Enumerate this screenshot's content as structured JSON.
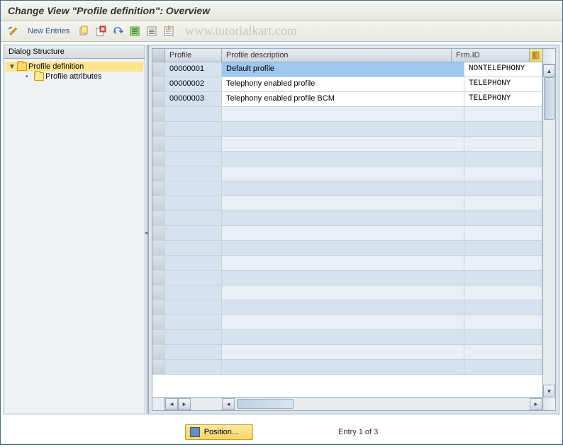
{
  "title": "Change View \"Profile definition\": Overview",
  "watermark": "www.tutorialkart.com",
  "toolbar": {
    "new_entries_label": "New Entries"
  },
  "tree": {
    "header": "Dialog Structure",
    "items": [
      {
        "label": "Profile definition",
        "level": 0,
        "expanded": true,
        "selected": true,
        "icon": "folder-open"
      },
      {
        "label": "Profile attributes",
        "level": 1,
        "expanded": false,
        "selected": false,
        "icon": "folder-closed"
      }
    ]
  },
  "table": {
    "columns": {
      "profile": "Profile",
      "desc": "Profile description",
      "frmid": "Frm.ID"
    },
    "rows": [
      {
        "profile": "00000001",
        "desc": "Default profile",
        "frmid": "NONTELEPHONY",
        "selected": true
      },
      {
        "profile": "00000002",
        "desc": "Telephony enabled profile",
        "frmid": "TELEPHONY",
        "selected": false
      },
      {
        "profile": "00000003",
        "desc": "Telephony enabled profile BCM",
        "frmid": "TELEPHONY",
        "selected": false
      }
    ],
    "empty_rows": 18
  },
  "footer": {
    "position_label": "Position...",
    "entry_text": "Entry 1 of 3"
  }
}
